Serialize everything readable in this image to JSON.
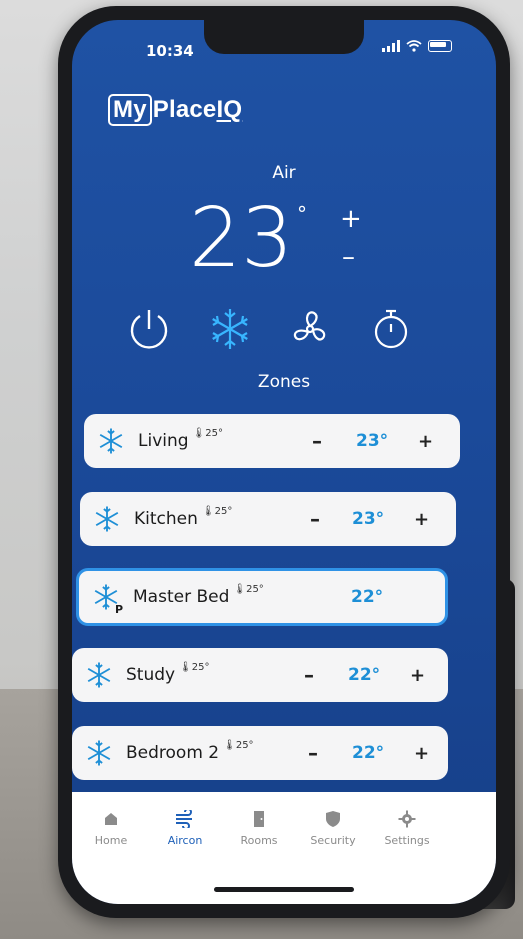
{
  "status": {
    "time": "10:34"
  },
  "brand": {
    "my": "My",
    "place": "Place",
    "iq": "IQ"
  },
  "air": {
    "label": "Air",
    "temperature": "23",
    "degree": "°",
    "plus": "+",
    "minus": "–"
  },
  "modes": [
    {
      "icon": "power-icon"
    },
    {
      "icon": "snowflake-icon",
      "active": true
    },
    {
      "icon": "fan-icon"
    },
    {
      "icon": "timer-icon"
    }
  ],
  "zones_label": "Zones",
  "zones": [
    {
      "name": "Living",
      "sensor": "25°",
      "minus": "–",
      "temp": "23°",
      "plus": "+"
    },
    {
      "name": "Kitchen",
      "sensor": "25°",
      "minus": "–",
      "temp": "23°",
      "plus": "+"
    },
    {
      "name": "Master Bed",
      "sensor": "25°",
      "temp": "22°",
      "badge": "P",
      "selected": true
    },
    {
      "name": "Study",
      "sensor": "25°",
      "minus": "–",
      "temp": "22°",
      "plus": "+"
    },
    {
      "name": "Bedroom 2",
      "sensor": "25°",
      "minus": "–",
      "temp": "22°",
      "plus": "+"
    }
  ],
  "nav": [
    {
      "label": "Home",
      "icon": "home-icon"
    },
    {
      "label": "Aircon",
      "icon": "wind-icon",
      "active": true
    },
    {
      "label": "Rooms",
      "icon": "door-icon"
    },
    {
      "label": "Security",
      "icon": "shield-icon"
    },
    {
      "label": "Settings",
      "icon": "gear-icon"
    }
  ],
  "colors": {
    "screen_bg": "#1b4a9a",
    "accent_temp": "#1e8fd6",
    "active_mode": "#38b6ff",
    "selected_border": "#2f92e6",
    "nav_active": "#1e60b8"
  }
}
